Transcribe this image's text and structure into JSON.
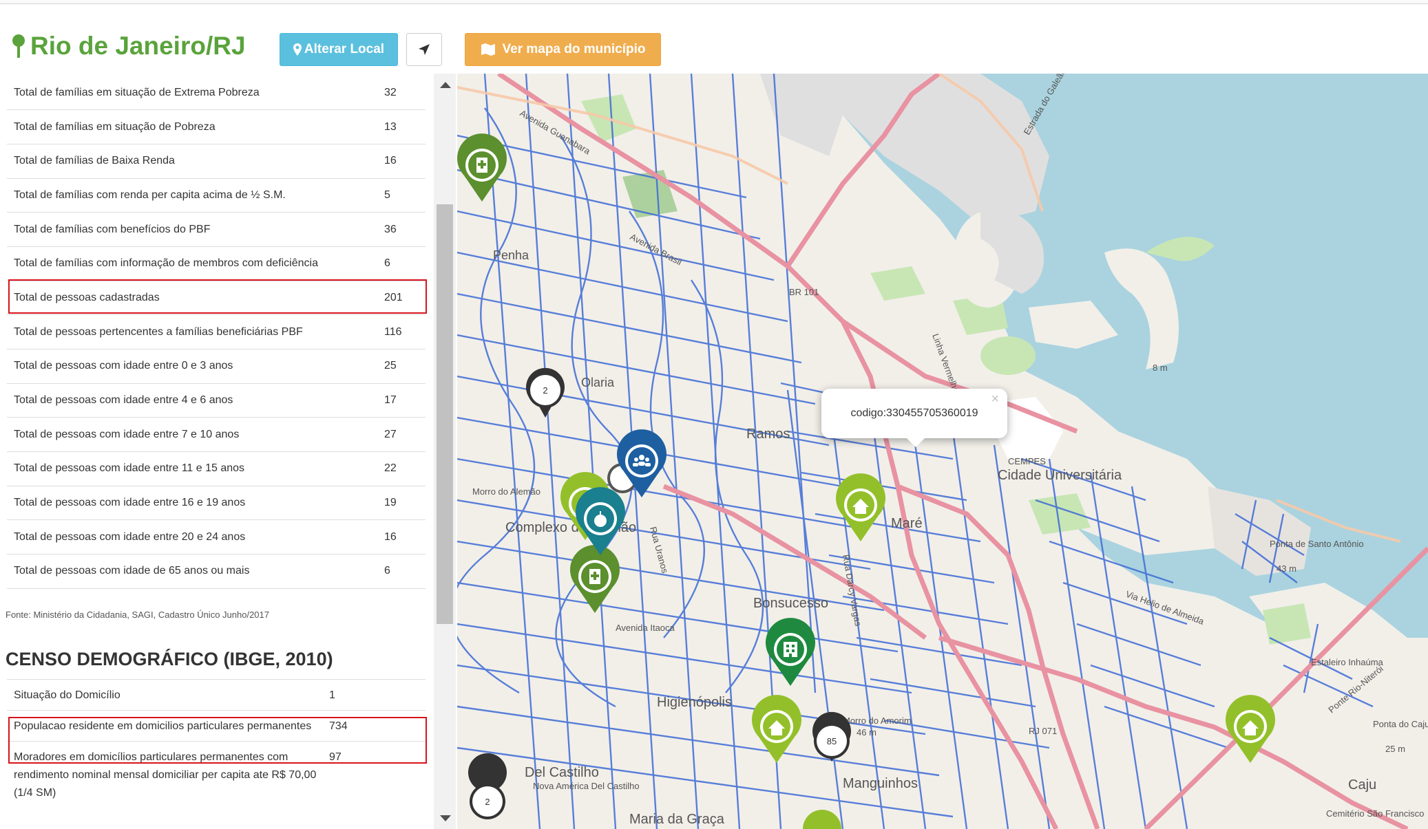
{
  "header": {
    "city": "Rio de Janeiro/RJ",
    "change_location_label": "Alterar Local",
    "view_map_label": "Ver mapa do município"
  },
  "stats": {
    "rows": [
      {
        "label": "Total de famílias em situação de Extrema Pobreza",
        "value": "32"
      },
      {
        "label": "Total de famílias em situação de Pobreza",
        "value": "13"
      },
      {
        "label": "Total de famílias de Baixa Renda",
        "value": "16"
      },
      {
        "label": "Total de famílias com renda per capita acima de ½ S.M.",
        "value": "5"
      },
      {
        "label": "Total de famílias com benefícios do PBF",
        "value": "36"
      },
      {
        "label": "Total de famílias com informação de membros com deficiência",
        "value": "6"
      },
      {
        "label": "Total de pessoas cadastradas",
        "value": "201"
      },
      {
        "label": "Total de pessoas pertencentes a famílias beneficiárias PBF",
        "value": "116"
      },
      {
        "label": "Total de pessoas com idade entre 0 e 3 anos",
        "value": "25"
      },
      {
        "label": "Total de pessoas com idade entre 4 e 6 anos",
        "value": "17"
      },
      {
        "label": "Total de pessoas com idade entre 7 e 10 anos",
        "value": "27"
      },
      {
        "label": "Total de pessoas com idade entre 11 e 15 anos",
        "value": "22"
      },
      {
        "label": "Total de pessoas com idade entre 16 e 19 anos",
        "value": "19"
      },
      {
        "label": "Total de pessoas com idade entre 20 e 24 anos",
        "value": "16"
      },
      {
        "label": "Total de pessoas com idade de 65 anos ou mais",
        "value": "6"
      }
    ],
    "source": "Fonte: Ministério da Cidadania, SAGI, Cadastro Único Junho/2017"
  },
  "censo": {
    "heading": "CENSO DEMOGRÁFICO (IBGE, 2010)",
    "rows": [
      {
        "label": "Situação do Domicílio",
        "value": "1"
      },
      {
        "label": "Populacao residente em domicilios particulares permanentes",
        "value": "734"
      },
      {
        "label": "Moradores em domicílios particulares permanentes com rendimento nominal mensal domiciliar per capita ate R$ 70,00 (1/4 SM)",
        "value": "97"
      }
    ]
  },
  "map": {
    "popup_text": "codigo:330455705360019",
    "popup_close": "×",
    "cluster_markers": [
      "2",
      "2",
      "85"
    ],
    "place_labels": [
      "Penha",
      "Olaria",
      "Ramos",
      "Bonsucesso",
      "Higienópolis",
      "Manguinhos",
      "Maré",
      "Cidade Universitária",
      "Maria da Graça",
      "Complexo do Alemão",
      "Morro do Alemão",
      "Morro do Amorim",
      "Ponta de Santo Antônio",
      "Cemitério São Francisco",
      "Del Castilho",
      "Nova América Del Castilho",
      "Estaleiro Inhaúma",
      "Ponta do Caju",
      "Caju",
      "CEMPES",
      "Avenida Brasil",
      "Linha Vermelha",
      "Avenida Itaoca",
      "BR 101",
      "RJ 071",
      "Ponte Rio-Niterói",
      "Via Helio de Almeida",
      "Estrada do Galeão",
      "Rua Uranos",
      "Rua Darcy Vargas",
      "Avenida Guanabara"
    ],
    "elevation_labels": [
      "8 m",
      "46 m",
      "43 m",
      "25 m"
    ],
    "colors": {
      "water": "#aad3df",
      "land": "#f2efe9",
      "street": "#3d6bd6",
      "highway": "#e892a2",
      "green_park": "#c8e6b4"
    }
  }
}
